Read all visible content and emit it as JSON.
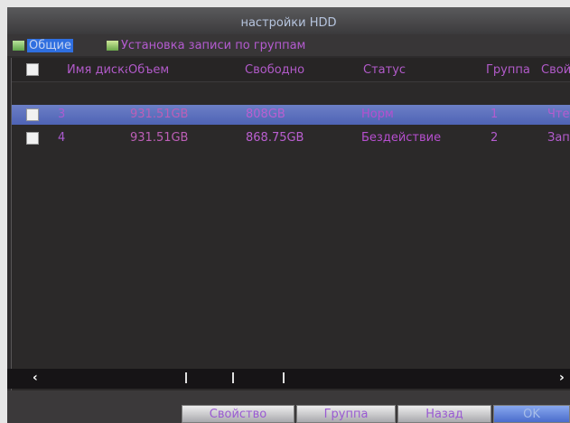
{
  "window": {
    "title": "настройки HDD"
  },
  "tabs": [
    {
      "label": "Общие"
    },
    {
      "label": "Установка записи по группам"
    }
  ],
  "table": {
    "columns": [
      "Имя диска",
      "Объем",
      "Свободно",
      "Статус",
      "Группа",
      "Свойство"
    ],
    "rows": [
      {
        "name": "3",
        "capacity": "931.51GB",
        "free": "808GB",
        "status": "Норм",
        "group": "1",
        "property": "Чтение/Запись",
        "selected": true
      },
      {
        "name": "4",
        "capacity": "931.51GB",
        "free": "868.75GB",
        "status": "Бездействие",
        "group": "2",
        "property": "Запись",
        "selected": false
      }
    ]
  },
  "buttons": {
    "property": "Свойство",
    "group": "Группа",
    "back": "Назад",
    "ok": "OK"
  }
}
